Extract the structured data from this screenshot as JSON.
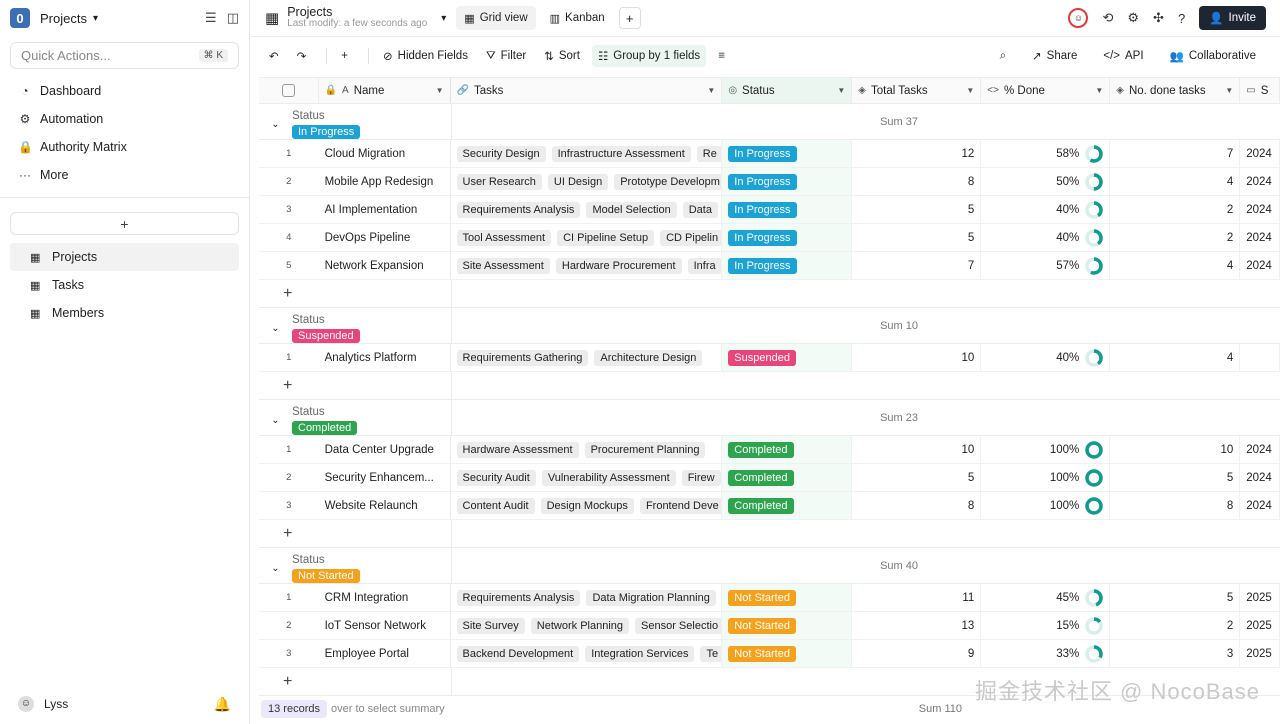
{
  "sidebar": {
    "logo": "0",
    "title": "Projects",
    "quick_actions": {
      "placeholder": "Quick Actions...",
      "shortcut": "⌘ K"
    },
    "nav": [
      {
        "label": "Dashboard",
        "icon": "dashboard-icon"
      },
      {
        "label": "Automation",
        "icon": "robot-icon"
      },
      {
        "label": "Authority Matrix",
        "icon": "lock-icon"
      },
      {
        "label": "More",
        "icon": "more-icon"
      }
    ],
    "add_label": "+",
    "sections": [
      {
        "label": "Projects",
        "active": true
      },
      {
        "label": "Tasks",
        "active": false
      },
      {
        "label": "Members",
        "active": false
      }
    ],
    "user": "Lyss"
  },
  "topbar": {
    "title": "Projects",
    "subtitle": "Last modify: a few seconds ago",
    "views": [
      {
        "label": "Grid view",
        "active": true
      },
      {
        "label": "Kanban",
        "active": false
      }
    ],
    "invite": "Invite"
  },
  "toolbar": {
    "hidden_fields": "Hidden Fields",
    "filter": "Filter",
    "sort": "Sort",
    "group": "Group by 1 fields",
    "share": "Share",
    "api": "API",
    "collaborative": "Collaborative"
  },
  "columns": {
    "name": "Name",
    "tasks": "Tasks",
    "status": "Status",
    "total": "Total Tasks",
    "pct": "% Done",
    "done": "No. done tasks",
    "date": "S"
  },
  "groups": [
    {
      "label": "Status",
      "status": "In Progress",
      "color": "#1ba3d6",
      "sum": "Sum 37",
      "rows": [
        {
          "idx": "1",
          "name": "Cloud Migration",
          "tasks": [
            "Security Design",
            "Infrastructure Assessment",
            "Re"
          ],
          "total": "12",
          "pct": "58%",
          "pct_value": 58,
          "done": "7",
          "date": "2024"
        },
        {
          "idx": "2",
          "name": "Mobile App Redesign",
          "tasks": [
            "User Research",
            "UI Design",
            "Prototype Developm"
          ],
          "total": "8",
          "pct": "50%",
          "pct_value": 50,
          "done": "4",
          "date": "2024"
        },
        {
          "idx": "3",
          "name": "AI Implementation",
          "tasks": [
            "Requirements Analysis",
            "Model Selection",
            "Data"
          ],
          "total": "5",
          "pct": "40%",
          "pct_value": 40,
          "done": "2",
          "date": "2024"
        },
        {
          "idx": "4",
          "name": "DevOps Pipeline",
          "tasks": [
            "Tool Assessment",
            "CI Pipeline Setup",
            "CD Pipelin"
          ],
          "total": "5",
          "pct": "40%",
          "pct_value": 40,
          "done": "2",
          "date": "2024"
        },
        {
          "idx": "5",
          "name": "Network Expansion",
          "tasks": [
            "Site Assessment",
            "Hardware Procurement",
            "Infra"
          ],
          "total": "7",
          "pct": "57%",
          "pct_value": 57,
          "done": "4",
          "date": "2024"
        }
      ]
    },
    {
      "label": "Status",
      "status": "Suspended",
      "color": "#e8457a",
      "sum": "Sum 10",
      "rows": [
        {
          "idx": "1",
          "name": "Analytics Platform",
          "tasks": [
            "Requirements Gathering",
            "Architecture Design"
          ],
          "total": "10",
          "pct": "40%",
          "pct_value": 40,
          "done": "4",
          "date": ""
        }
      ]
    },
    {
      "label": "Status",
      "status": "Completed",
      "color": "#2ea44f",
      "sum": "Sum 23",
      "rows": [
        {
          "idx": "1",
          "name": "Data Center Upgrade",
          "tasks": [
            "Hardware Assessment",
            "Procurement Planning"
          ],
          "total": "10",
          "pct": "100%",
          "pct_value": 100,
          "done": "10",
          "date": "2024"
        },
        {
          "idx": "2",
          "name": "Security Enhancem...",
          "tasks": [
            "Security Audit",
            "Vulnerability Assessment",
            "Firew"
          ],
          "total": "5",
          "pct": "100%",
          "pct_value": 100,
          "done": "5",
          "date": "2024"
        },
        {
          "idx": "3",
          "name": "Website Relaunch",
          "tasks": [
            "Content Audit",
            "Design Mockups",
            "Frontend Deve"
          ],
          "total": "8",
          "pct": "100%",
          "pct_value": 100,
          "done": "8",
          "date": "2024"
        }
      ]
    },
    {
      "label": "Status",
      "status": "Not Started",
      "color": "#f5a11c",
      "sum": "Sum 40",
      "rows": [
        {
          "idx": "1",
          "name": "CRM Integration",
          "tasks": [
            "Requirements Analysis",
            "Data Migration Planning"
          ],
          "total": "11",
          "pct": "45%",
          "pct_value": 45,
          "done": "5",
          "date": "2025"
        },
        {
          "idx": "2",
          "name": "IoT Sensor Network",
          "tasks": [
            "Site Survey",
            "Network Planning",
            "Sensor Selectio"
          ],
          "total": "13",
          "pct": "15%",
          "pct_value": 15,
          "done": "2",
          "date": "2025"
        },
        {
          "idx": "3",
          "name": "Employee Portal",
          "tasks": [
            "Backend Development",
            "Integration Services",
            "Te"
          ],
          "total": "9",
          "pct": "33%",
          "pct_value": 33,
          "done": "3",
          "date": "2025"
        }
      ]
    }
  ],
  "footer": {
    "records": "13 records",
    "hint": "over to select summary",
    "sum": "Sum 110"
  },
  "watermark": "掘金技术社区 @ NocoBase",
  "colors": {
    "ring": "#0f9b8e",
    "ring_bg": "#d7efec"
  }
}
